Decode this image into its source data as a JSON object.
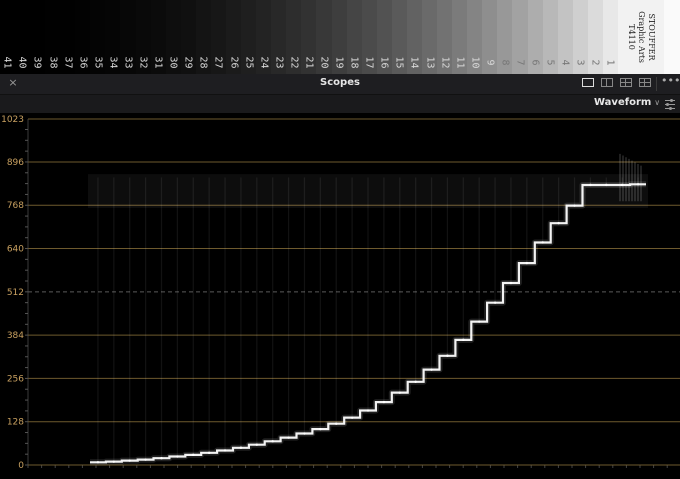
{
  "step_strip": {
    "steps": [
      "41",
      "40",
      "39",
      "38",
      "37",
      "36",
      "35",
      "34",
      "33",
      "32",
      "31",
      "30",
      "29",
      "28",
      "27",
      "26",
      "25",
      "24",
      "23",
      "22",
      "21",
      "20",
      "19",
      "18",
      "17",
      "16",
      "15",
      "14",
      "13",
      "12",
      "11",
      "10",
      "9",
      "8",
      "7",
      "6",
      "5",
      "4",
      "3",
      "2",
      "1"
    ],
    "brand_lines": [
      "STOUFFER",
      "Graphic Arts",
      "T4110"
    ]
  },
  "panel": {
    "close_icon": "×",
    "title": "Scopes",
    "layout_options": [
      "single-view-icon",
      "dual-view-icon",
      "quad-view-icon",
      "four-panel-icon"
    ],
    "more_icon": "•••",
    "scope_type": "Waveform",
    "settings_icon": "sliders-icon"
  },
  "scope": {
    "y_ticks": [
      "1023",
      "896",
      "768",
      "640",
      "512",
      "384",
      "256",
      "128",
      "0"
    ],
    "colors": {
      "grid": "#6e5a2e",
      "label": "#c8a060",
      "trace": "#ffffff"
    }
  },
  "chart_data": {
    "type": "line",
    "title": "",
    "xlabel": "",
    "ylabel": "",
    "ylim": [
      0,
      1023
    ],
    "y_ticks": [
      0,
      128,
      256,
      384,
      512,
      640,
      768,
      896,
      1023
    ],
    "reference_line": 512,
    "series": [
      {
        "values": [
          8,
          10,
          13,
          16,
          20,
          25,
          30,
          36,
          43,
          51,
          60,
          70,
          81,
          93,
          106,
          122,
          140,
          161,
          186,
          214,
          246,
          282,
          323,
          370,
          424,
          480,
          538,
          597,
          658,
          715,
          767,
          828,
          828,
          828,
          830
        ]
      }
    ]
  }
}
